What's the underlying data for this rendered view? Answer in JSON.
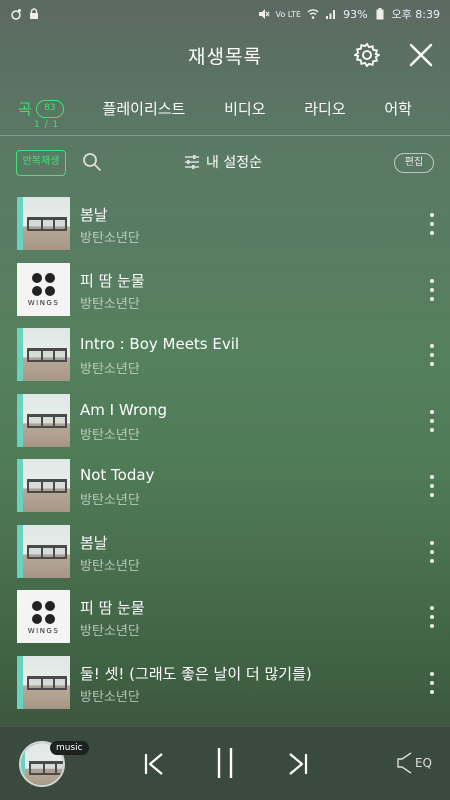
{
  "status_bar": {
    "left_icons": [
      "notification-icon",
      "lock-icon"
    ],
    "network_label": "Vo LTE",
    "battery": "93%",
    "time": "오후 8:39"
  },
  "header": {
    "title": "재생목록",
    "settings_icon": "gear-icon",
    "close_icon": "close-icon"
  },
  "tabs": [
    {
      "label": "곡",
      "active": true,
      "badge": "83"
    },
    {
      "label": "플레이리스트"
    },
    {
      "label": "비디오"
    },
    {
      "label": "라디오"
    },
    {
      "label": "어학"
    }
  ],
  "tab_sub": "1 / 1",
  "toolbar": {
    "repeat_label": "반복재생",
    "sort_label": "내 설정순",
    "edit_label": "편집"
  },
  "songs": [
    {
      "title": "봄날",
      "artist": "방탄소년단",
      "art": "spring"
    },
    {
      "title": "피 땀 눈물",
      "artist": "방탄소년단",
      "art": "wings"
    },
    {
      "title": "Intro : Boy Meets Evil",
      "artist": "방탄소년단",
      "art": "spring"
    },
    {
      "title": "Am I Wrong",
      "artist": "방탄소년단",
      "art": "spring"
    },
    {
      "title": "Not Today",
      "artist": "방탄소년단",
      "art": "spring"
    },
    {
      "title": "봄날",
      "artist": "방탄소년단",
      "art": "spring"
    },
    {
      "title": "피 땀 눈물",
      "artist": "방탄소년단",
      "art": "wings"
    },
    {
      "title": "둘! 셋! (그래도 좋은 날이 더 많기를)",
      "artist": "방탄소년단",
      "art": "spring"
    }
  ],
  "wings_text": "WINGS",
  "player": {
    "badge": "music",
    "eq_label": "EQ"
  },
  "colors": {
    "accent": "#3fe37a",
    "player_bg": "#3b4a3e"
  }
}
